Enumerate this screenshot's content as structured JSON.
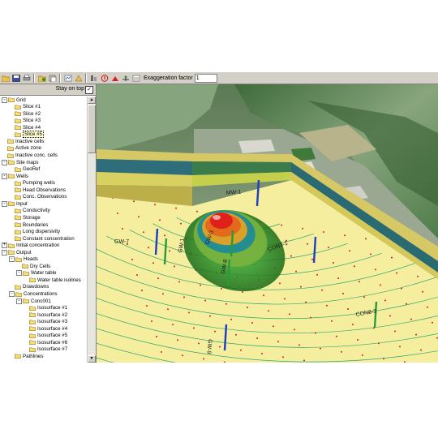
{
  "toolbar": {
    "exaggeration_label": "Exaggeration factor",
    "exaggeration_value": "1",
    "icons": [
      "open-folder-icon",
      "save-icon",
      "print-icon",
      "copy-icon",
      "paste-icon",
      "import-icon",
      "export-icon",
      "layers-icon",
      "info-icon",
      "stop-icon",
      "run-icon",
      "settings-icon"
    ]
  },
  "sidebar": {
    "stay_on_top_label": "Stay on top",
    "stay_on_top_checked": "✓",
    "tree": [
      {
        "label": "Grid",
        "level": 0,
        "expander": "-"
      },
      {
        "label": "Slice #1",
        "level": 1,
        "expander": ""
      },
      {
        "label": "Slice #2",
        "level": 1,
        "expander": ""
      },
      {
        "label": "Slice #3",
        "level": 1,
        "expander": ""
      },
      {
        "label": "Slice #4",
        "level": 1,
        "expander": ""
      },
      {
        "label": "Slice #5",
        "level": 1,
        "expander": "",
        "selected": true
      },
      {
        "label": "Inactive cells",
        "level": 0,
        "expander": ""
      },
      {
        "label": "Active zone",
        "level": 0,
        "expander": ""
      },
      {
        "label": "Inactive conc. cells",
        "level": 0,
        "expander": ""
      },
      {
        "label": "Site maps",
        "level": 0,
        "expander": "-"
      },
      {
        "label": "GeoRef",
        "level": 1,
        "expander": ""
      },
      {
        "label": "Wells",
        "level": 0,
        "expander": "-"
      },
      {
        "label": "Pumping wells",
        "level": 1,
        "expander": ""
      },
      {
        "label": "Head Observations",
        "level": 1,
        "expander": ""
      },
      {
        "label": "Conc. Observations",
        "level": 1,
        "expander": ""
      },
      {
        "label": "Input",
        "level": 0,
        "expander": "-"
      },
      {
        "label": "Conductivity",
        "level": 1,
        "expander": ""
      },
      {
        "label": "Storage",
        "level": 1,
        "expander": ""
      },
      {
        "label": "Boundaries",
        "level": 1,
        "expander": ""
      },
      {
        "label": "Long dispersivity",
        "level": 1,
        "expander": ""
      },
      {
        "label": "Constant concentration",
        "level": 1,
        "expander": ""
      },
      {
        "label": "Initial concentration",
        "level": 0,
        "expander": "+"
      },
      {
        "label": "Output",
        "level": 0,
        "expander": "-"
      },
      {
        "label": "Heads",
        "level": 1,
        "expander": "-"
      },
      {
        "label": "Dry Cells",
        "level": 2,
        "expander": ""
      },
      {
        "label": "Water table",
        "level": 2,
        "expander": "-"
      },
      {
        "label": "Water table isolines",
        "level": 3,
        "expander": ""
      },
      {
        "label": "Drawdowns",
        "level": 1,
        "expander": ""
      },
      {
        "label": "Concentrations",
        "level": 1,
        "expander": "-"
      },
      {
        "label": "Conc001",
        "level": 2,
        "expander": "-"
      },
      {
        "label": "Isosurface #1",
        "level": 3,
        "expander": ""
      },
      {
        "label": "Isosurface #2",
        "level": 3,
        "expander": ""
      },
      {
        "label": "Isosurface #3",
        "level": 3,
        "expander": ""
      },
      {
        "label": "Isosurface #4",
        "level": 3,
        "expander": ""
      },
      {
        "label": "Isosurface #5",
        "level": 3,
        "expander": ""
      },
      {
        "label": "Isosurface #6",
        "level": 3,
        "expander": ""
      },
      {
        "label": "Isosurface #7",
        "level": 3,
        "expander": ""
      },
      {
        "label": "Pathlines",
        "level": 1,
        "expander": ""
      }
    ]
  },
  "viewport": {
    "wells": [
      {
        "label": "GW-3"
      },
      {
        "label": "GW-9"
      },
      {
        "label": "GW-8"
      },
      {
        "label": "GW-7"
      },
      {
        "label": "GW-1"
      },
      {
        "label": "CON3-1"
      },
      {
        "label": "CON3-3"
      },
      {
        "label": "MW-1"
      }
    ],
    "colors": {
      "isoline": "#2aa66a",
      "grid_dots": "#cc2222",
      "ground": "#f5ee9e",
      "plume_outer": "#1f8a1f",
      "plume_core": "#e0201a"
    }
  }
}
